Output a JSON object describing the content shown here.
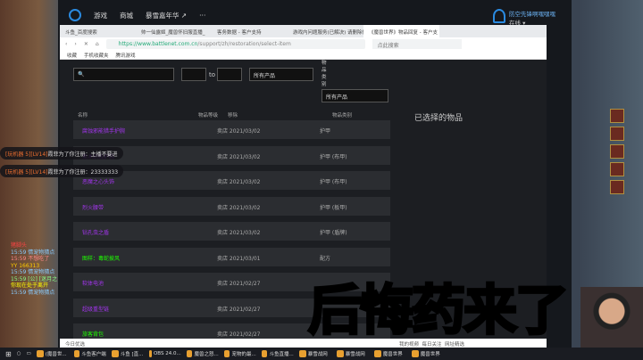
{
  "client": {
    "nav": [
      "游戏",
      "商城",
      "暴雪嘉年华 ↗",
      "···"
    ],
    "username": "防空先锋啊嘿嘿嘿",
    "status": "在线 ▾"
  },
  "browser": {
    "tabs": [
      "斗鱼_百度搜索",
      "帅一仙露姬_魔兽怀旧服直播_",
      "客务数据 - 客户支持",
      "游戏内问题服务(已解决) 请删除你",
      "《魔兽世界》物品回复 - 客户支 ×"
    ],
    "url_host": "https://www.battlenet.com.cn",
    "url_path": "/support/zh/restoration/select-item",
    "search_placeholder": "点此搜索",
    "bookmarks": [
      "收藏",
      "手机收藏夹",
      "腾讯游戏"
    ],
    "status_left": "今日优选",
    "status_right": [
      "我的视频",
      "每日关注",
      "网址精选"
    ]
  },
  "page": {
    "to": "to",
    "product_filter": "所有产品",
    "category_label": "物品类别",
    "category_filter": "所有产品",
    "selected_title": "已选择的物品",
    "headers": [
      "名称",
      "物品等级",
      "移除",
      "物品类别"
    ],
    "rows": [
      {
        "name": "腐蚀邪能猎手护腕",
        "date": "卖店 2021/03/02",
        "cat": "护甲",
        "color": "purple"
      },
      {
        "name": "奥术织线护腕",
        "date": "卖店 2021/03/02",
        "cat": "护甲 (布甲)",
        "color": "purple"
      },
      {
        "name": "恶魔之心头饰",
        "date": "卖店 2021/03/02",
        "cat": "护甲 (布甲)",
        "color": "purple"
      },
      {
        "name": "烈火腰带",
        "date": "卖店 2021/03/02",
        "cat": "护甲 (板甲)",
        "color": "purple"
      },
      {
        "name": "钻孔虫之盾",
        "date": "卖店 2021/03/02",
        "cat": "护甲 (盾牌)",
        "color": "purple"
      },
      {
        "name": "图样：毒蛇披风",
        "date": "卖店 2021/03/01",
        "cat": "配方",
        "color": "green"
      },
      {
        "name": "软体电池",
        "date": "卖店 2021/02/27",
        "cat": "",
        "color": "purple"
      },
      {
        "name": "超级重型链",
        "date": "卖店 2021/02/27",
        "cat": "",
        "color": "purple"
      },
      {
        "name": "旅客背包",
        "date": "卖店 2021/02/27",
        "cat": "",
        "color": "green"
      }
    ]
  },
  "danmu": [
    {
      "lv": "[玩机器 5][LV14]",
      "text": "霞菲为了你注册：主播不要进"
    },
    {
      "lv": "[玩机器 5][LV14]",
      "text": "霞菲为了你注册：23333333"
    }
  ],
  "chat": [
    "猪脚头",
    "15:59 情宠物猜点",
    "15:59 不想吃了",
    "YY 166313",
    "15:59 情宠物猜点",
    "15:59 [公] [迷月之",
    "你现在处于离开",
    "15:59 情宠物猜点"
  ],
  "caption": "后悔药来了",
  "taskbar": [
    "(魔兽世...",
    "斗鱼客户端",
    "斗鱼 [直...",
    "OBS 24.0...",
    "魔兽之怒...",
    "宠物的最...",
    "斗鱼直播...",
    "暴雪战网",
    "暴雪战网",
    "魔兽世界",
    "魔兽世界"
  ]
}
